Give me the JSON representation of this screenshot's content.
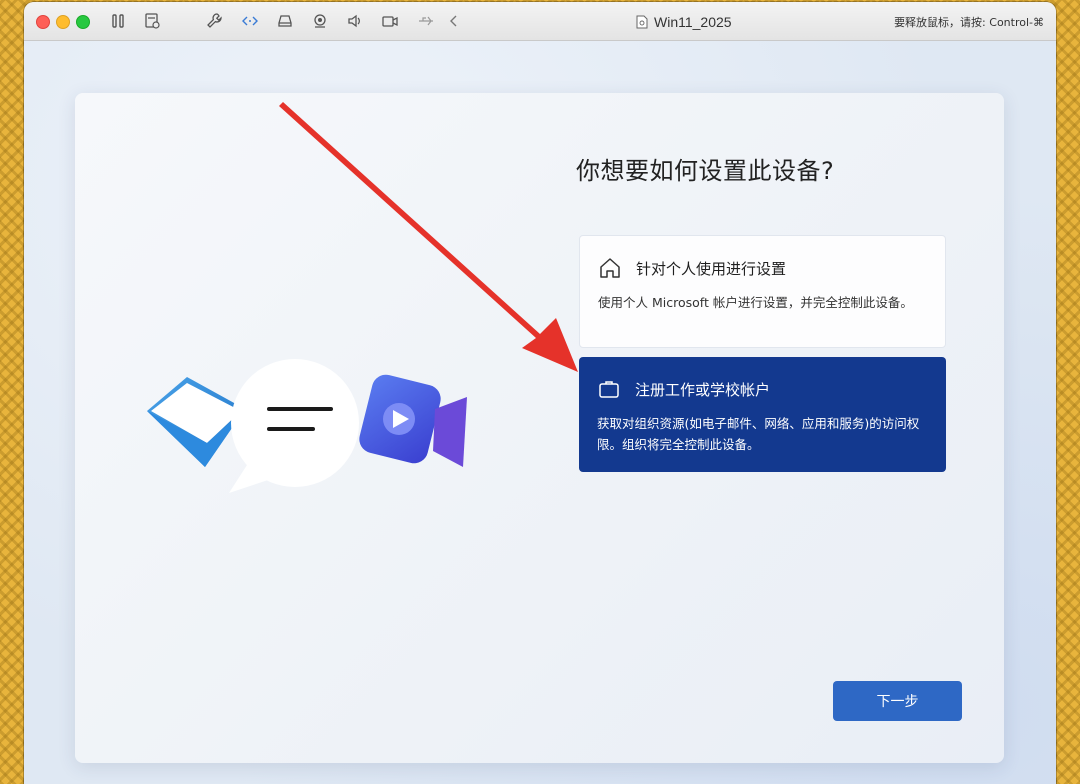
{
  "window": {
    "title": "Win11_2025",
    "release_hint": "要释放鼠标，请按: Control-⌘"
  },
  "toolbar": {
    "icons": [
      "pause-icon",
      "snapshot-icon",
      "wrench-icon",
      "code-arrows-icon",
      "drive-icon",
      "camera-icon",
      "speaker-icon",
      "video-icon",
      "usb-icon",
      "back-chevron-icon"
    ]
  },
  "setup": {
    "heading": "你想要如何设置此设备?",
    "options": [
      {
        "icon": "home-icon",
        "title": "针对个人使用进行设置",
        "description": "使用个人 Microsoft 帐户进行设置，并完全控制此设备。",
        "selected": false
      },
      {
        "icon": "briefcase-icon",
        "title": "注册工作或学校帐户",
        "description": "获取对组织资源(如电子邮件、网络、应用和服务)的访问权限。组织将完全控制此设备。",
        "selected": true
      }
    ],
    "next_label": "下一步"
  },
  "colors": {
    "selected_card": "#13398f",
    "next_button": "#2e68c5",
    "annotation_arrow": "#e5322a"
  }
}
